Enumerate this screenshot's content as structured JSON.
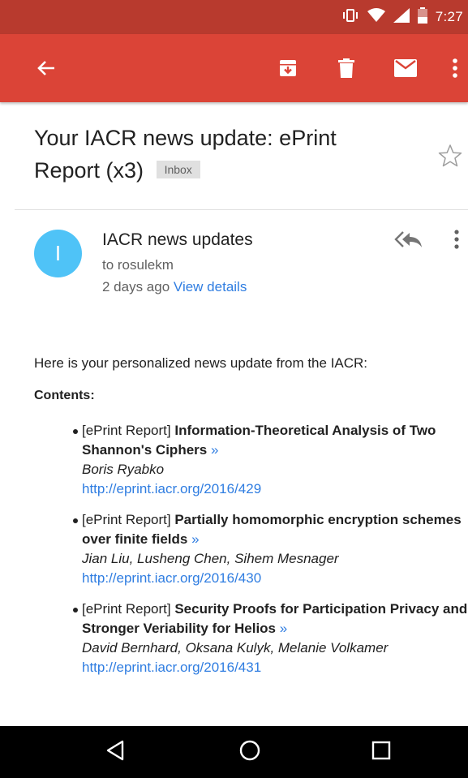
{
  "status_bar": {
    "time": "7:27"
  },
  "app_bar": {
    "back_icon": "arrow-left-icon",
    "archive_icon": "archive-icon",
    "delete_icon": "trash-icon",
    "mail_icon": "mail-icon",
    "more_icon": "more-vert-icon"
  },
  "email": {
    "subject": "Your IACR news update: ePrint Report (x3)",
    "label": "Inbox",
    "sender": {
      "avatar_letter": "I",
      "name": "IACR news updates",
      "to": "to rosulekm",
      "date": "2 days ago",
      "view_details": "View details"
    },
    "intro": "Here is your personalized news update from the IACR:",
    "contents_heading": "Contents:",
    "items": [
      {
        "prefix": "[ePrint Report]",
        "title": "Information-Theoretical Analysis of Two Shannon's Ciphers",
        "arrow": "»",
        "authors": "Boris Ryabko",
        "link": "http://eprint.iacr.org/2016/429"
      },
      {
        "prefix": "[ePrint Report]",
        "title": "Partially homomorphic encryption schemes over finite fields",
        "arrow": "»",
        "authors": "Jian Liu, Lusheng Chen, Sihem Mesnager",
        "link": "http://eprint.iacr.org/2016/430"
      },
      {
        "prefix": "[ePrint Report]",
        "title": "Security Proofs for Participation Privacy and Stronger Veriability for Helios",
        "arrow": "»",
        "authors": "David Bernhard, Oksana Kulyk, Melanie Volkamer",
        "link": "http://eprint.iacr.org/2016/431"
      }
    ]
  },
  "colors": {
    "status_bar": "#b83a2e",
    "app_bar": "#db4437",
    "avatar": "#4fc3f7",
    "link": "#2f7de1"
  }
}
